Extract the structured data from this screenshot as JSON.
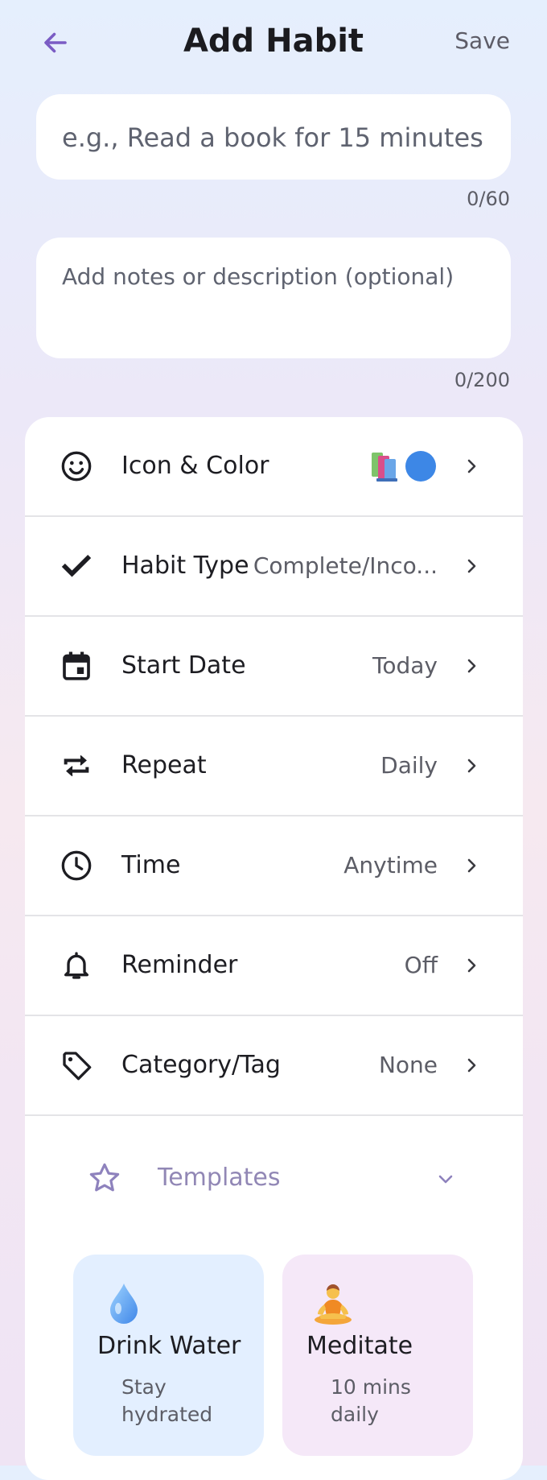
{
  "header": {
    "title": "Add Habit",
    "save_label": "Save"
  },
  "name_field": {
    "placeholder": "e.g., Read a book for 15 minutes",
    "value": "",
    "counter": "0/60"
  },
  "notes_field": {
    "placeholder": "Add notes or description (optional)",
    "value": "",
    "counter": "0/200"
  },
  "settings": [
    {
      "label": "Icon & Color",
      "value": "",
      "icon": "smiley-icon"
    },
    {
      "label": "Habit Type",
      "value": "Complete/Inco...",
      "icon": "check-icon"
    },
    {
      "label": "Start Date",
      "value": "Today",
      "icon": "calendar-icon"
    },
    {
      "label": "Repeat",
      "value": "Daily",
      "icon": "repeat-icon"
    },
    {
      "label": "Time",
      "value": "Anytime",
      "icon": "clock-icon"
    },
    {
      "label": "Reminder",
      "value": "Off",
      "icon": "bell-icon"
    },
    {
      "label": "Category/Tag",
      "value": "None",
      "icon": "tag-icon"
    }
  ],
  "icon_color": {
    "icon": "books-icon",
    "color": "#3d87e6"
  },
  "templates": {
    "label": "Templates",
    "items": [
      {
        "title": "Drink Water",
        "subtitle": "Stay hydrated",
        "icon": "water-drop-icon",
        "color": "#e3efff"
      },
      {
        "title": "Meditate",
        "subtitle": "10 mins daily",
        "icon": "meditation-icon",
        "color": "#f5e8f8"
      }
    ]
  },
  "colors": {
    "accent": "#7b5cc4",
    "muted_purple": "#9187b5"
  }
}
